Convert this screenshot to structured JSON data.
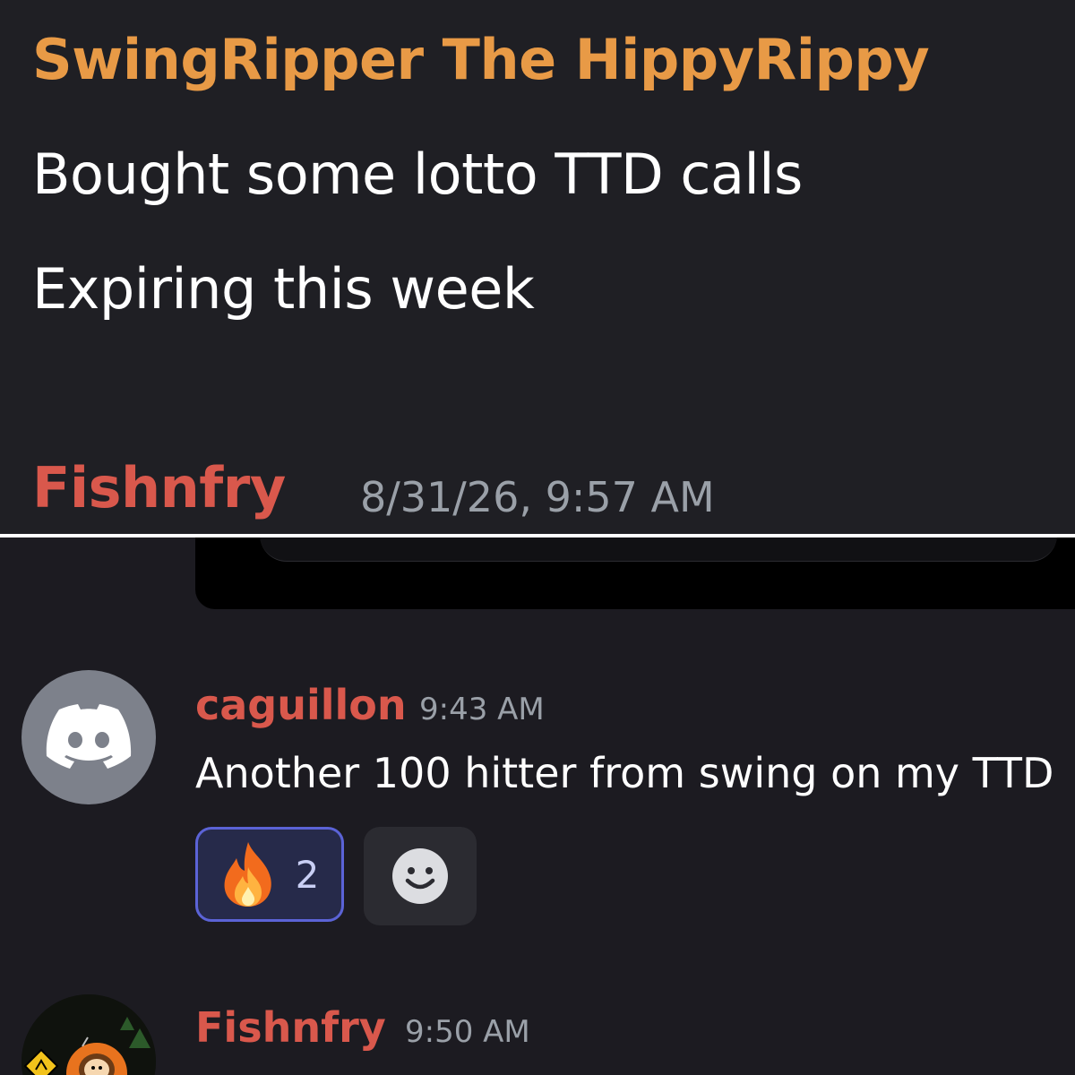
{
  "top_message": {
    "author": "SwingRipper The HippyRippy",
    "lines": [
      "Bought some lotto TTD calls",
      "Expiring this week"
    ],
    "author_color": "#e89a46"
  },
  "top_footer": {
    "author": "Fishnfry",
    "timestamp": "8/31/26, 9:57 AM",
    "author_color": "#d9584c"
  },
  "messages": [
    {
      "author": "caguillon",
      "timestamp": "9:43 AM",
      "text": "Another 100 hitter from swing on my TTD",
      "avatar_icon": "discord-logo-icon",
      "reactions": [
        {
          "emoji": "fire-emoji-icon",
          "count": "2",
          "selected": true
        }
      ]
    },
    {
      "author": "Fishnfry",
      "timestamp": "9:50 AM",
      "avatar_icon": "kenny-avatar-icon"
    }
  ],
  "colors": {
    "background": "#1e1e24",
    "username_red": "#d9584c",
    "username_orange": "#e89a46",
    "timestamp": "#9aa0a8",
    "reaction_border": "#5b63d6"
  }
}
